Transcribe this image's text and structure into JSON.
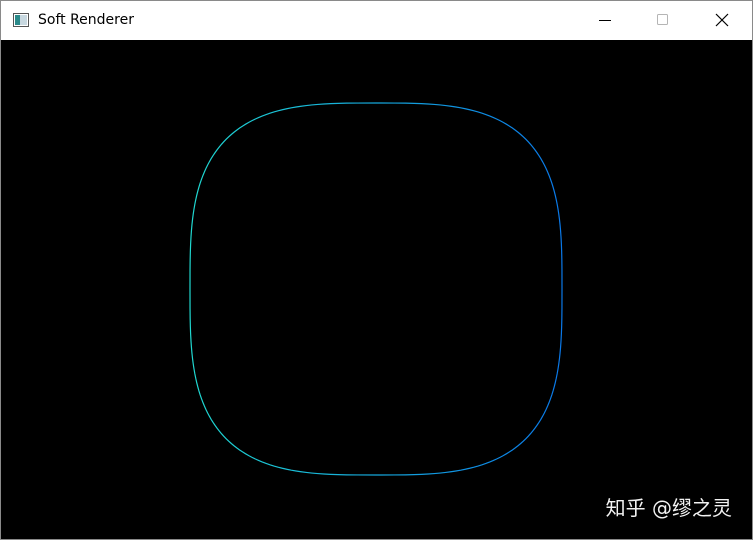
{
  "window": {
    "title": "Soft Renderer",
    "icon": "window-app-icon",
    "controls": {
      "minimize_icon": "minimize-icon",
      "maximize_icon": "maximize-icon",
      "close_icon": "close-icon"
    }
  },
  "viewport": {
    "background_color": "#000000",
    "render_mode": "wireframe sphere",
    "gradient_colors": {
      "left": "#20d8d0",
      "right": "#0a78e8"
    }
  },
  "watermark": {
    "text": "知乎 @缪之灵"
  }
}
